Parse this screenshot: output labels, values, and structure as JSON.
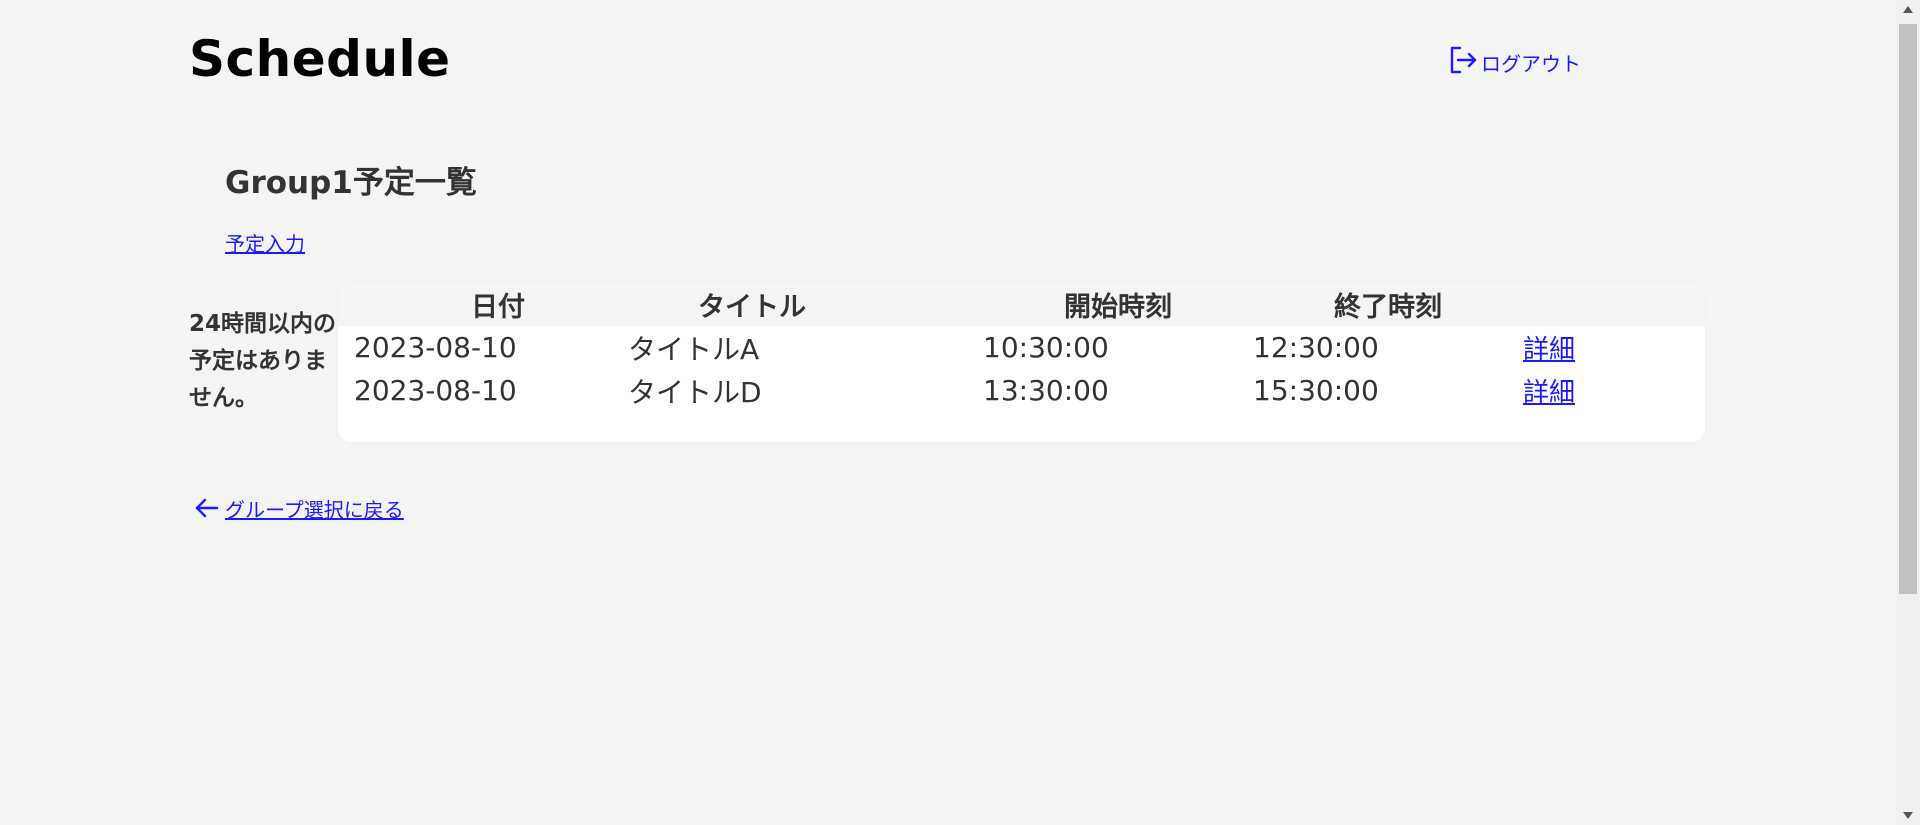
{
  "header": {
    "title": "Schedule",
    "logout_label": "ログアウト"
  },
  "main": {
    "group_heading": "Group1予定一覧",
    "schedule_input_label": "予定入力",
    "no_schedule_note": "24時間以内の予定はありません。",
    "table": {
      "columns": [
        "日付",
        "タイトル",
        "開始時刻",
        "終了時刻"
      ],
      "rows": [
        {
          "date": "2023-08-10",
          "title": "タイトルA",
          "start": "10:30:00",
          "end": "12:30:00",
          "detail_label": "詳細"
        },
        {
          "date": "2023-08-10",
          "title": "タイトルD",
          "start": "13:30:00",
          "end": "15:30:00",
          "detail_label": "詳細"
        }
      ]
    },
    "back_label": "グループ選択に戻る"
  },
  "colors": {
    "link": "#1a1aff",
    "background": "#f4f4f4"
  }
}
